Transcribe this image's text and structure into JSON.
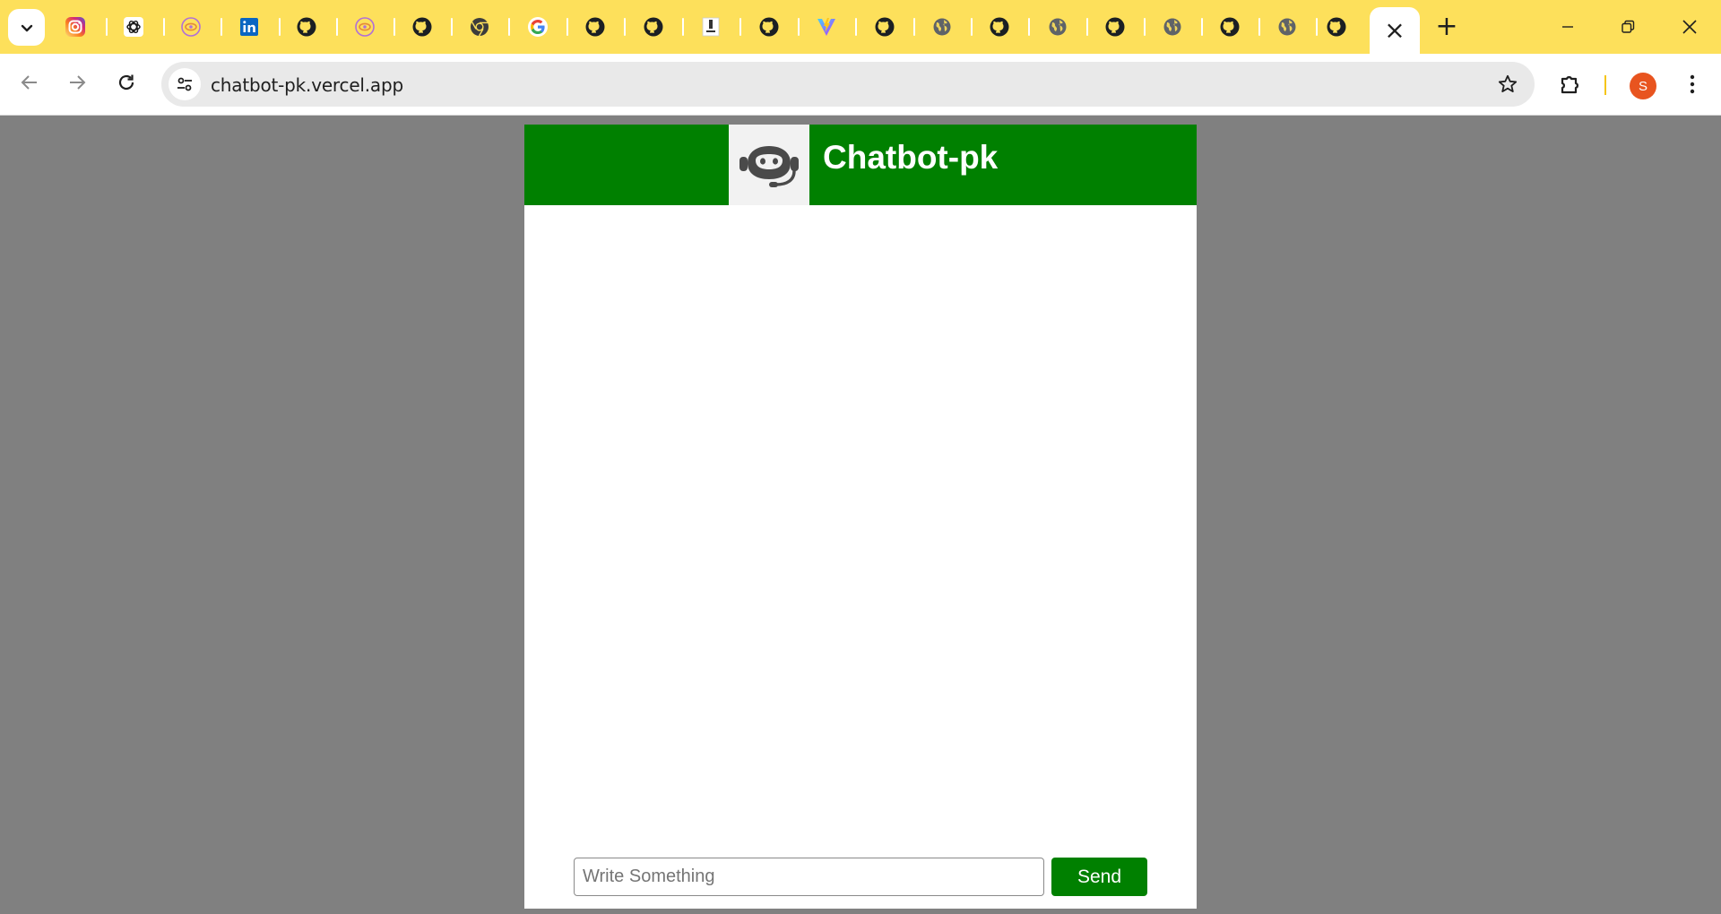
{
  "browser": {
    "tabs": [
      {
        "icon": "tab-search-icon"
      },
      {
        "icon": "instagram-icon"
      },
      {
        "icon": "openai-icon"
      },
      {
        "icon": "purple-eye-icon"
      },
      {
        "icon": "linkedin-icon"
      },
      {
        "icon": "github-icon"
      },
      {
        "icon": "purple-eye-icon"
      },
      {
        "icon": "github-icon"
      },
      {
        "icon": "chrome-icon"
      },
      {
        "icon": "google-icon"
      },
      {
        "icon": "github-icon"
      },
      {
        "icon": "github-icon"
      },
      {
        "icon": "document-icon"
      },
      {
        "icon": "github-icon"
      },
      {
        "icon": "vite-icon"
      },
      {
        "icon": "github-icon"
      },
      {
        "icon": "globe-icon"
      },
      {
        "icon": "github-icon"
      },
      {
        "icon": "globe-icon"
      },
      {
        "icon": "github-icon"
      },
      {
        "icon": "globe-icon"
      },
      {
        "icon": "github-icon"
      },
      {
        "icon": "globe-icon"
      },
      {
        "icon": "github-icon"
      }
    ],
    "active_tab_close": "×",
    "new_tab": "+",
    "window_controls": [
      "minimize",
      "restore",
      "close"
    ],
    "url": "chatbot-pk.vercel.app",
    "profile_initial": "S",
    "colors": {
      "tabstrip": "#fde05b",
      "avatar": "#e8541f"
    }
  },
  "chatbot": {
    "title": "Chatbot-pk",
    "logo_icon": "robot-headset-icon",
    "input_placeholder": "Write Something",
    "input_value": "",
    "send_label": "Send",
    "colors": {
      "header": "#008000",
      "send_button": "#008000",
      "page_background": "#808080"
    }
  }
}
